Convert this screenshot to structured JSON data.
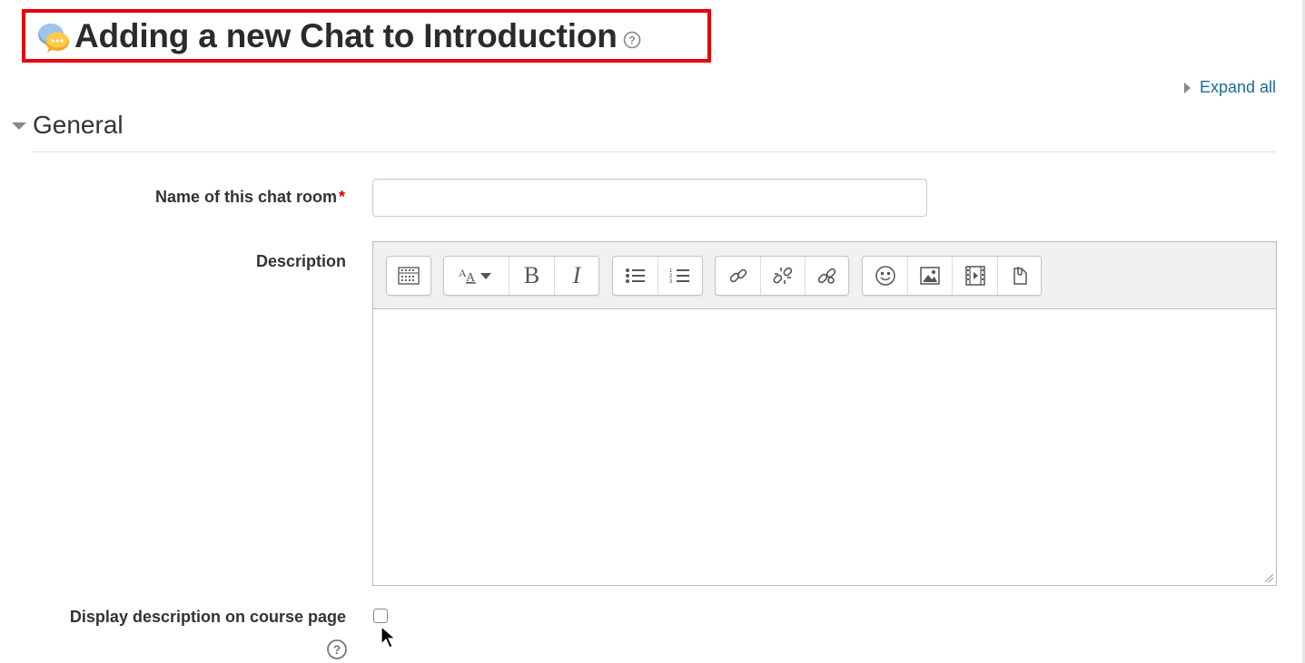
{
  "page": {
    "title": "Adding a new Chat to Introduction",
    "title_icon": "chat-activity-icon",
    "help_icon": "help-icon"
  },
  "expand_all": {
    "label": "Expand all"
  },
  "section": {
    "title": "General"
  },
  "fields": {
    "name": {
      "label": "Name of this chat room",
      "required_mark": "*",
      "value": "",
      "placeholder": ""
    },
    "description": {
      "label": "Description"
    },
    "display_description": {
      "label": "Display description on course page",
      "checked": false
    }
  },
  "editor_toolbar": {
    "groups": [
      [
        "toolbar-toggle-icon"
      ],
      [
        "font-style-icon",
        "bold-icon",
        "italic-icon"
      ],
      [
        "unordered-list-icon",
        "ordered-list-icon"
      ],
      [
        "link-icon",
        "unlink-icon",
        "autolink-icon"
      ],
      [
        "emoticon-icon",
        "image-icon",
        "media-icon",
        "manage-files-icon"
      ]
    ],
    "bold_glyph": "B",
    "italic_glyph": "I"
  },
  "colors": {
    "highlight": "#e8000b",
    "link": "#1a6c96",
    "required": "#cc0000"
  }
}
